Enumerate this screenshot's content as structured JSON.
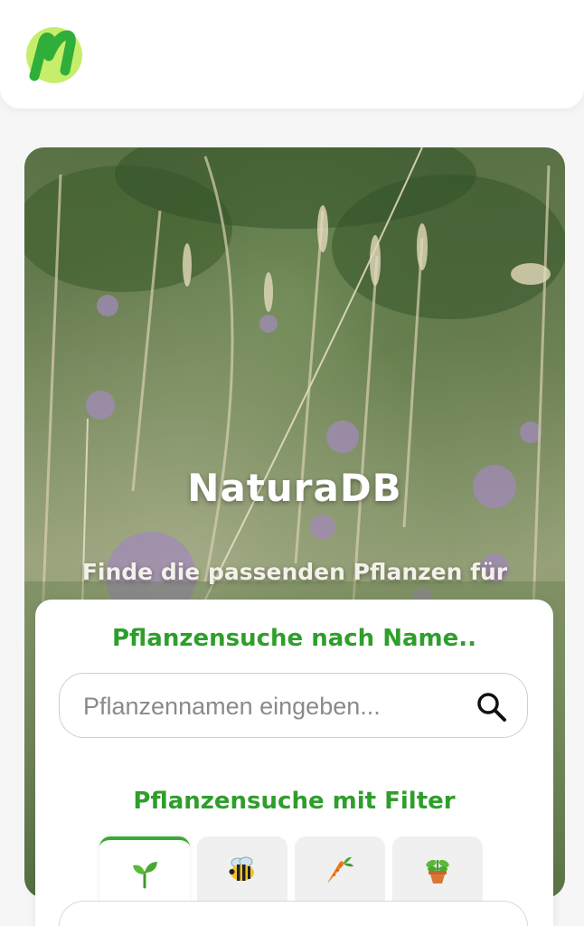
{
  "header": {
    "logo_icon": "naturadb-logo-icon",
    "brand_color": "#2f9e2b"
  },
  "hero": {
    "title": "NaturaDB",
    "subtitle": "Finde die passenden Pflanzen für deinen Garten, deine Terrasse oder deinen Balkon!"
  },
  "search": {
    "title": "Pflanzensuche nach Name..",
    "placeholder": "Pflanzennamen eingeben...",
    "value": "",
    "button_icon": "search-icon"
  },
  "filter": {
    "title": "Pflanzensuche mit Filter",
    "tabs": [
      {
        "icon": "seedling-icon",
        "active": true
      },
      {
        "icon": "bee-icon",
        "active": false
      },
      {
        "icon": "carrot-icon",
        "active": false
      },
      {
        "icon": "potted-plant-icon",
        "active": false
      }
    ]
  },
  "colors": {
    "accent": "#2f9e2b",
    "tab_active_border": "#3aa935",
    "tab_inactive_bg": "#f0f0f0"
  }
}
